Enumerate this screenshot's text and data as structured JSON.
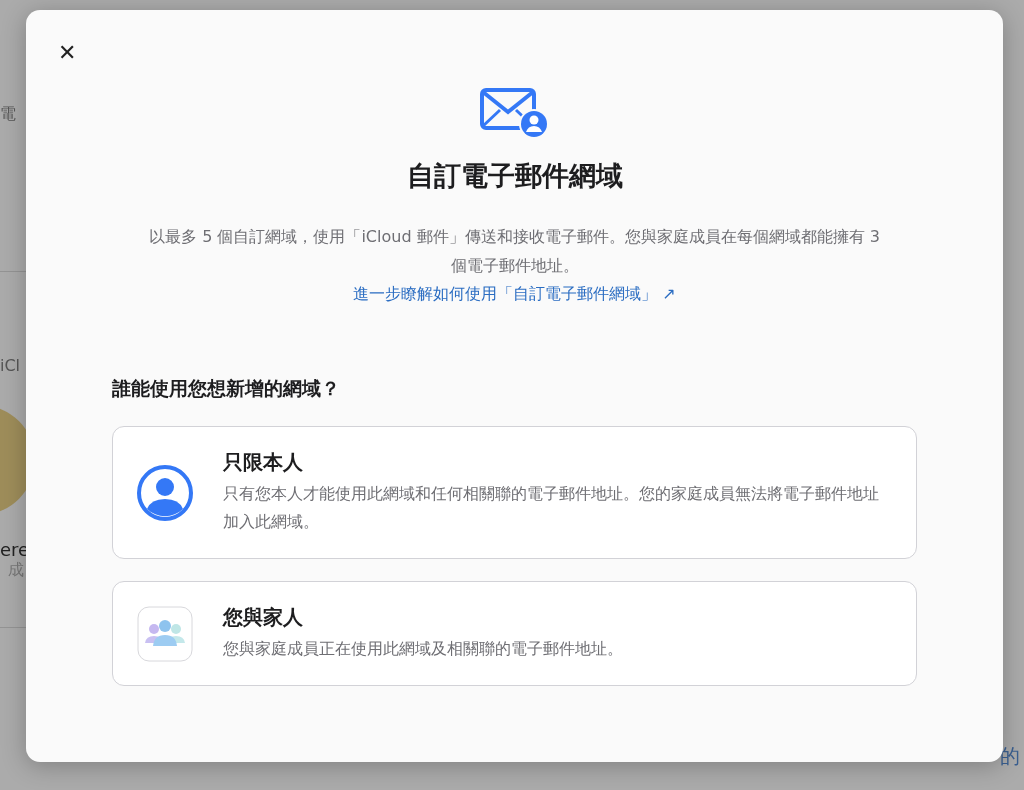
{
  "background_page": {
    "left_fragments": [
      {
        "kind": "heading",
        "text": "電"
      },
      {
        "kind": "label",
        "text": "iCl"
      },
      {
        "kind": "avatar"
      },
      {
        "kind": "name",
        "text": "ere"
      },
      {
        "kind": "role",
        "text": "成"
      }
    ],
    "bottom_right_fragment": "的"
  },
  "dialog": {
    "close_label": "✕",
    "title": "自訂電子郵件網域",
    "description": "以最多 5 個自訂網域，使用「iCloud 郵件」傳送和接收電子郵件。您與家庭成員在每個網域都能擁有 3 個電子郵件地址。",
    "learn_more_link": "進一步瞭解如何使用「自訂電子郵件網域」 ↗",
    "question": "誰能使用您想新增的網域？",
    "options": [
      {
        "kind": "personal",
        "title": "只限本人",
        "description": "只有您本人才能使用此網域和任何相關聯的電子郵件地址。您的家庭成員無法將電子郵件地址加入此網域。"
      },
      {
        "kind": "family",
        "title": "您與家人",
        "description": "您與家庭成員正在使用此網域及相關聯的電子郵件地址。"
      }
    ]
  }
}
